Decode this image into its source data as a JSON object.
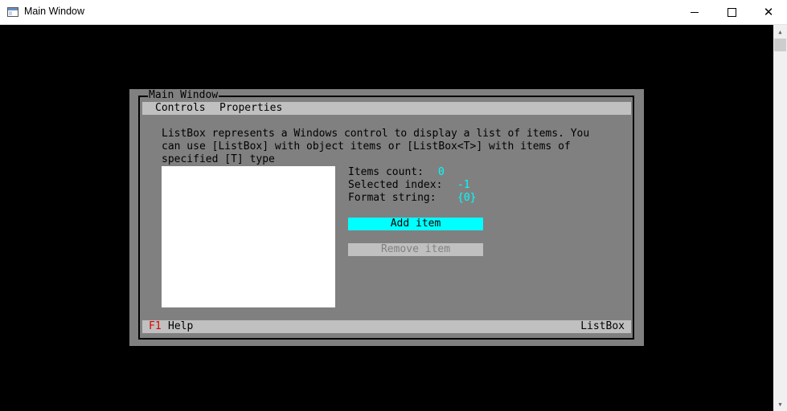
{
  "window": {
    "title": "Main Window",
    "minimize_icon": "minimize-icon",
    "maximize_icon": "maximize-icon",
    "close_icon": "close-icon"
  },
  "tui": {
    "title": "Main Window",
    "menu": [
      "Controls",
      "Properties"
    ],
    "description": "ListBox represents a Windows control to display a list of items. You\ncan use [ListBox] with object items or [ListBox<T>] with items of\nspecified [T] type",
    "properties": [
      {
        "label": "Items count:",
        "value": "0"
      },
      {
        "label": "Selected index:",
        "value": "-1"
      },
      {
        "label": "Format string:",
        "value": "{0}"
      }
    ],
    "add_button": "Add item",
    "remove_button": "Remove item",
    "status": {
      "key": "F1",
      "key_label": "Help",
      "right": "ListBox"
    }
  },
  "colors": {
    "accent": "#00ffff",
    "panel": "#808080",
    "bar": "#c0c0c0",
    "hotkey": "#e00000"
  }
}
